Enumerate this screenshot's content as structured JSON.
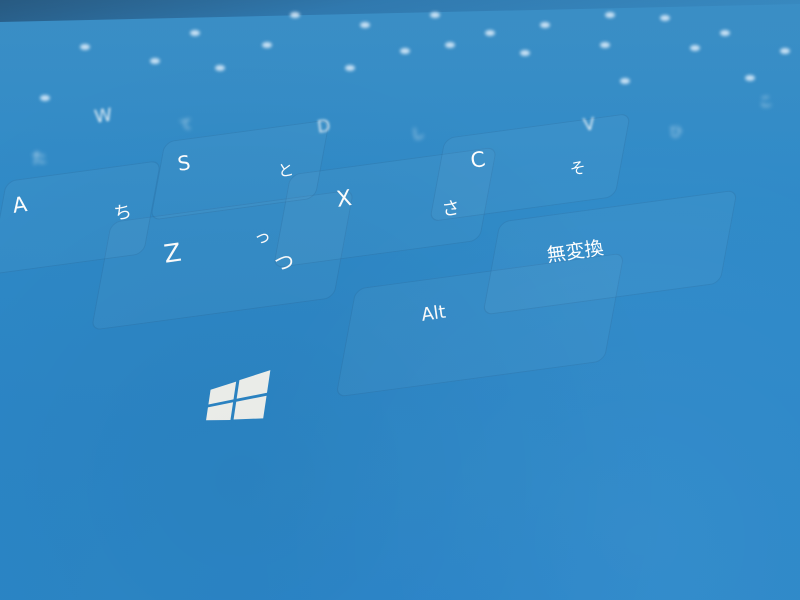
{
  "keys": {
    "w": "W",
    "s": "S",
    "a": "A",
    "z": "Z",
    "x": "X",
    "c": "C",
    "d": "D",
    "v": "V",
    "alt": "Alt",
    "muhenkan": "無変換"
  },
  "kana": {
    "te": "て",
    "to": "と",
    "chi": "ち",
    "tsu_small": "っ",
    "tsu": "つ",
    "sa": "さ",
    "so": "そ",
    "shi": "し",
    "hi": "ひ",
    "ta": "た",
    "ko": "こ"
  },
  "colors": {
    "keyboard_blue": "#2f86c6",
    "legend_white": "#ffffff"
  },
  "icons": {
    "windows": "windows-logo-icon"
  }
}
